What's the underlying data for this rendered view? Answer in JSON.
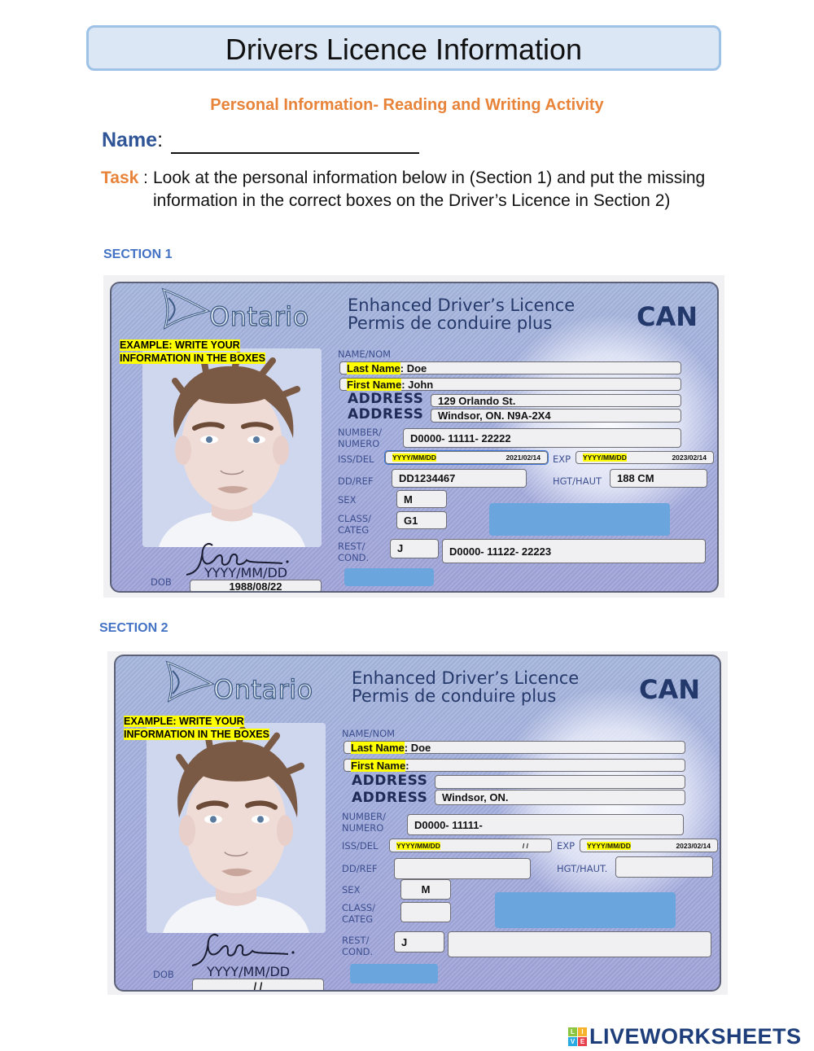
{
  "header": {
    "title": "Drivers Licence Information",
    "subtitle": "Personal Information- Reading and Writing Activity",
    "name_label": "Name",
    "name_colon": ":",
    "task_label": "Task",
    "task_lead": ":",
    "task_text": "Look at the personal information below in (Section 1) and put the missing information in the correct boxes on the Driver’s Licence in Section 2)"
  },
  "colors": {
    "accent_orange": "#e8833a",
    "accent_blue": "#2f5597",
    "section_blue": "#4472c4",
    "highlight": "#ffff00",
    "card_blue": "#a3aede",
    "redaction_blue": "#6aa5dd"
  },
  "sections": [
    {
      "label": "SECTION 1",
      "card": {
        "province": "Ontario",
        "title_en": "Enhanced Driver’s Licence",
        "title_fr": "Permis de conduire plus",
        "country": "CAN",
        "example_line1": "EXAMPLE: WRITE YOUR",
        "example_line2": "INFORMATION IN THE BOXES",
        "name_nom_label": "NAME/NOM",
        "last_name_label": "Last Name",
        "last_name_value": ": Doe",
        "first_name_label": "First Name",
        "first_name_value": ": John",
        "address_label": "ADDRESS",
        "address1_value": "129 Orlando St.",
        "address2_value": "Windsor, ON. N9A-2X4",
        "number_label_1": "NUMBER/",
        "number_label_2": "NUMERO",
        "number_value": "D0000- 11111- 22222",
        "iss_label": "ISS/DEL",
        "iss_format": "YYYY/MM/DD",
        "iss_value": "2021/02/14",
        "exp_label": "EXP",
        "exp_format": "YYYY/MM/DD",
        "exp_value": "2023/02/14",
        "ddref_label": "DD/REF",
        "ddref_value": "DD1234467",
        "hgt_label": "HGT/HAUT",
        "hgt_value": "188 CM",
        "sex_label": "SEX",
        "sex_value": "M",
        "class_label_1": "CLASS/",
        "class_label_2": "CATEG",
        "class_value": "G1",
        "rest_label_1": "REST/",
        "rest_label_2": "COND.",
        "rest_value": "J",
        "cond_value": "D0000- 11122- 22223",
        "dob_label": "DOB",
        "dob_format": "YYYY/MM/DD",
        "dob_value": "1988/08/22",
        "signature": "Jdoe."
      }
    },
    {
      "label": "SECTION 2",
      "card": {
        "province": "Ontario",
        "title_en": "Enhanced Driver’s Licence",
        "title_fr": "Permis de conduire plus",
        "country": "CAN",
        "example_line1": "EXAMPLE: WRITE YOUR",
        "example_line2": "INFORMATION IN THE BOXES",
        "name_nom_label": "NAME/NOM",
        "last_name_label": "Last Name",
        "last_name_value": ": Doe",
        "first_name_label": "First Name",
        "first_name_value": ":",
        "address_label": "ADDRESS",
        "address1_value": "",
        "address2_value": "Windsor, ON.",
        "number_label_1": "NUMBER/",
        "number_label_2": "NUMERO",
        "number_value": "D0000- 11111-",
        "iss_label": "ISS/DEL",
        "iss_format": "YYYY/MM/DD",
        "iss_value": "/        /",
        "exp_label": "EXP",
        "exp_format": "YYYY/MM/DD",
        "exp_value": "2023/02/14",
        "ddref_label": "DD/REF",
        "ddref_value": "",
        "hgt_label": "HGT/HAUT.",
        "hgt_value": "",
        "sex_label": "SEX",
        "sex_value": "M",
        "class_label_1": "CLASS/",
        "class_label_2": "CATEG",
        "class_value": "",
        "rest_label_1": "REST/",
        "rest_label_2": "COND.",
        "rest_value": "J",
        "cond_value": "",
        "dob_label": "DOB",
        "dob_format": "YYYY/MM/DD",
        "dob_value": "/        /",
        "signature": "Jdoe."
      }
    }
  ],
  "footer": {
    "brand": "LIVEWORKSHEETS",
    "brand_blocks": [
      "L",
      "I",
      "V",
      "E"
    ]
  }
}
